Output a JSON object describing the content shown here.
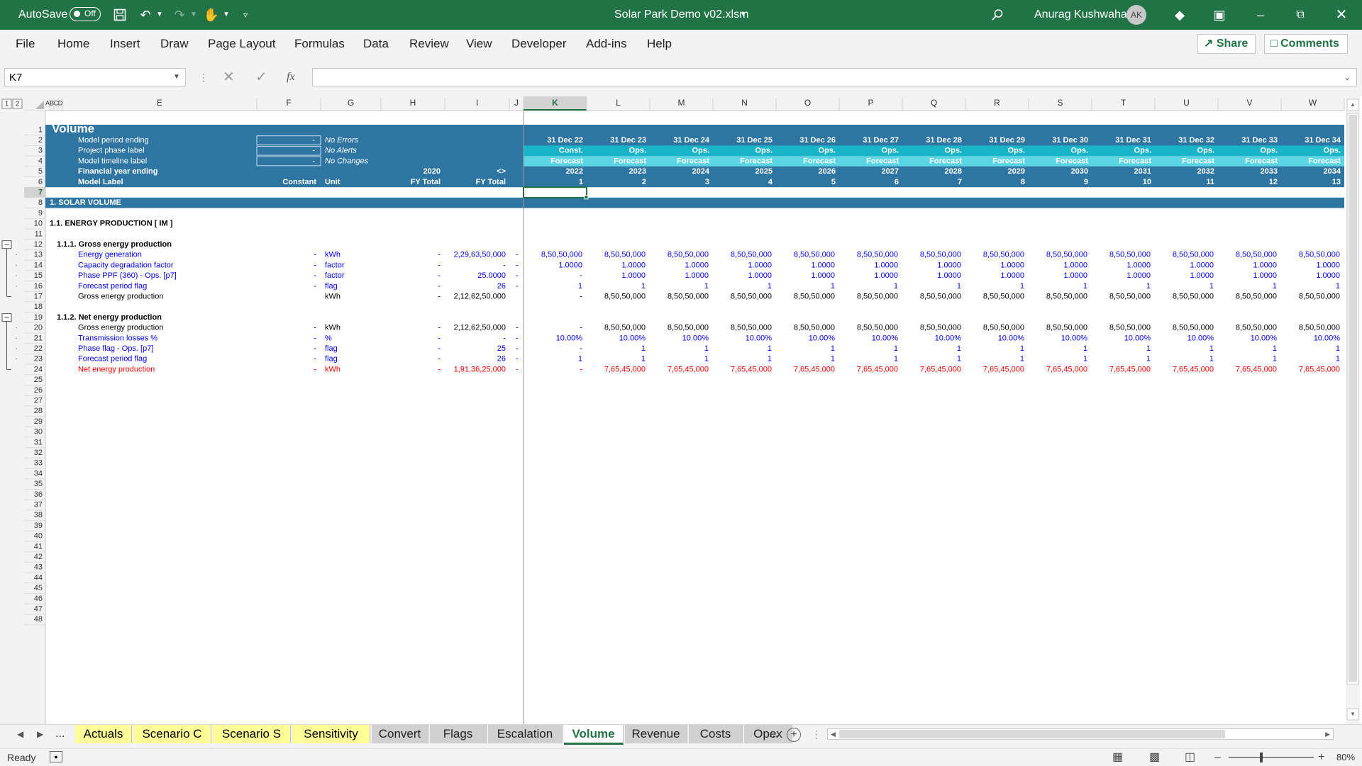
{
  "titlebar": {
    "autosave_label": "AutoSave",
    "autosave_state": "Off",
    "file_name": "Solar Park Demo v02.xlsm",
    "user_name": "Anurag Kushwaha",
    "user_initials": "AK"
  },
  "ribbon": {
    "tabs": [
      "File",
      "Home",
      "Insert",
      "Draw",
      "Page Layout",
      "Formulas",
      "Data",
      "Review",
      "View",
      "Developer",
      "Add-ins",
      "Help"
    ],
    "share_label": "Share",
    "comments_label": "Comments"
  },
  "formula_bar": {
    "name_box": "K7",
    "fx_label": "fx",
    "formula": ""
  },
  "grid": {
    "outline_levels": [
      "1",
      "2"
    ],
    "col_headers": {
      "fixed": [
        "A",
        "B",
        "C",
        "D",
        "E",
        "F",
        "G",
        "H",
        "I",
        "J"
      ],
      "timeline": [
        "K",
        "L",
        "M",
        "N",
        "O",
        "P",
        "Q",
        "R",
        "S",
        "T",
        "U",
        "V",
        "W"
      ]
    },
    "header_block": {
      "title": "Volume",
      "labels": [
        "Model period ending",
        "Project phase label",
        "Model timeline label",
        "Financial year ending",
        "Model Label"
      ],
      "inputs": [
        "-",
        "-",
        "-"
      ],
      "checks": [
        "No Errors",
        "No Alerts",
        "No Changes"
      ],
      "fy_h": "2020",
      "fy_i": "<>",
      "row6": {
        "constant": "Constant",
        "unit": "Unit",
        "h": "FY Total",
        "i": "FY Total"
      },
      "dates": [
        "31 Dec 22",
        "31 Dec 23",
        "31 Dec 24",
        "31 Dec 25",
        "31 Dec 26",
        "31 Dec 27",
        "31 Dec 28",
        "31 Dec 29",
        "31 Dec 30",
        "31 Dec 31",
        "31 Dec 32",
        "31 Dec 33",
        "31 Dec 34"
      ],
      "phases": [
        "Const.",
        "Ops.",
        "Ops.",
        "Ops.",
        "Ops.",
        "Ops.",
        "Ops.",
        "Ops.",
        "Ops.",
        "Ops.",
        "Ops.",
        "Ops.",
        "Ops."
      ],
      "timeline_labels": [
        "Forecast",
        "Forecast",
        "Forecast",
        "Forecast",
        "Forecast",
        "Forecast",
        "Forecast",
        "Forecast",
        "Forecast",
        "Forecast",
        "Forecast",
        "Forecast",
        "Forecast"
      ],
      "fy": [
        "2022",
        "2023",
        "2024",
        "2025",
        "2026",
        "2027",
        "2028",
        "2029",
        "2030",
        "2031",
        "2032",
        "2033",
        "2034"
      ],
      "labels_num": [
        "1",
        "2",
        "3",
        "4",
        "5",
        "6",
        "7",
        "8",
        "9",
        "10",
        "11",
        "12",
        "13"
      ]
    },
    "section_title": "1. SOLAR VOLUME",
    "sub1_title": "1.1. ENERGY PRODUCTION [ IM ]",
    "g1_title": "1.1.1. Gross energy production",
    "g2_title": "1.1.2. Net energy production",
    "rows": [
      {
        "row": 13,
        "label": "Energy generation",
        "f": "-",
        "unit": "kWh",
        "h": "-",
        "i": "2,29,63,50,000",
        "j": "-",
        "style": "input",
        "values": [
          "8,50,50,000",
          "8,50,50,000",
          "8,50,50,000",
          "8,50,50,000",
          "8,50,50,000",
          "8,50,50,000",
          "8,50,50,000",
          "8,50,50,000",
          "8,50,50,000",
          "8,50,50,000",
          "8,50,50,000",
          "8,50,50,000",
          "8,50,50,000"
        ]
      },
      {
        "row": 14,
        "label": "Capacity degradation factor",
        "f": "-",
        "unit": "factor",
        "h": "-",
        "i": "-",
        "j": "-",
        "style": "input",
        "values": [
          "1.0000",
          "1.0000",
          "1.0000",
          "1.0000",
          "1.0000",
          "1.0000",
          "1.0000",
          "1.0000",
          "1.0000",
          "1.0000",
          "1.0000",
          "1.0000",
          "1.0000"
        ]
      },
      {
        "row": 15,
        "label": "Phase PPF (360) - Ops. [p7]",
        "f": "-",
        "unit": "factor",
        "h": "-",
        "i": "25.0000",
        "j": "-",
        "style": "input",
        "values": [
          "-",
          "1.0000",
          "1.0000",
          "1.0000",
          "1.0000",
          "1.0000",
          "1.0000",
          "1.0000",
          "1.0000",
          "1.0000",
          "1.0000",
          "1.0000",
          "1.0000"
        ]
      },
      {
        "row": 16,
        "label": "Forecast period flag",
        "f": "-",
        "unit": "flag",
        "h": "-",
        "i": "26",
        "j": "-",
        "style": "input",
        "values": [
          "1",
          "1",
          "1",
          "1",
          "1",
          "1",
          "1",
          "1",
          "1",
          "1",
          "1",
          "1",
          "1"
        ]
      },
      {
        "row": 17,
        "label": "Gross energy production",
        "f": "",
        "unit": "kWh",
        "h": "-",
        "i": "2,12,62,50,000",
        "j": "",
        "style": "calc",
        "values": [
          "-",
          "8,50,50,000",
          "8,50,50,000",
          "8,50,50,000",
          "8,50,50,000",
          "8,50,50,000",
          "8,50,50,000",
          "8,50,50,000",
          "8,50,50,000",
          "8,50,50,000",
          "8,50,50,000",
          "8,50,50,000",
          "8,50,50,000"
        ]
      },
      {
        "row": 20,
        "label": "Gross energy production",
        "f": "-",
        "unit": "kWh",
        "h": "-",
        "i": "2,12,62,50,000",
        "j": "-",
        "style": "calc",
        "values": [
          "-",
          "8,50,50,000",
          "8,50,50,000",
          "8,50,50,000",
          "8,50,50,000",
          "8,50,50,000",
          "8,50,50,000",
          "8,50,50,000",
          "8,50,50,000",
          "8,50,50,000",
          "8,50,50,000",
          "8,50,50,000",
          "8,50,50,000"
        ]
      },
      {
        "row": 21,
        "label": "Transmission losses %",
        "f": "-",
        "unit": "%",
        "h": "-",
        "i": "-",
        "j": "-",
        "style": "input",
        "values": [
          "10.00%",
          "10.00%",
          "10.00%",
          "10.00%",
          "10.00%",
          "10.00%",
          "10.00%",
          "10.00%",
          "10.00%",
          "10.00%",
          "10.00%",
          "10.00%",
          "10.00%"
        ]
      },
      {
        "row": 22,
        "label": "Phase flag - Ops. [p7]",
        "f": "-",
        "unit": "flag",
        "h": "-",
        "i": "25",
        "j": "-",
        "style": "input",
        "values": [
          "-",
          "1",
          "1",
          "1",
          "1",
          "1",
          "1",
          "1",
          "1",
          "1",
          "1",
          "1",
          "1"
        ]
      },
      {
        "row": 23,
        "label": "Forecast period flag",
        "f": "-",
        "unit": "flag",
        "h": "-",
        "i": "26",
        "j": "-",
        "style": "input",
        "values": [
          "1",
          "1",
          "1",
          "1",
          "1",
          "1",
          "1",
          "1",
          "1",
          "1",
          "1",
          "1",
          "1"
        ]
      },
      {
        "row": 24,
        "label": "Net energy production",
        "f": "-",
        "unit": "kWh",
        "h": "-",
        "i": "1,91,36,25,000",
        "j": "-",
        "style": "output",
        "values": [
          "-",
          "7,65,45,000",
          "7,65,45,000",
          "7,65,45,000",
          "7,65,45,000",
          "7,65,45,000",
          "7,65,45,000",
          "7,65,45,000",
          "7,65,45,000",
          "7,65,45,000",
          "7,65,45,000",
          "7,65,45,000",
          "7,65,45,000"
        ]
      }
    ],
    "colors": {
      "header_blue": "#2e75a2",
      "phase_teal": "#1ab4c9",
      "timeline_cyan": "#5bd4e3",
      "input_blue": "#0000ff",
      "output_red": "#ff0000"
    }
  },
  "sheet_tabs": {
    "left_ellipsis": "...",
    "right_ellipsis": "...",
    "tabs": [
      {
        "name": "Actuals",
        "style": "yellow"
      },
      {
        "name": "Scenario C",
        "style": "yellow"
      },
      {
        "name": "Scenario S",
        "style": "yellow"
      },
      {
        "name": "Sensitivity",
        "style": "yellow"
      },
      {
        "name": "Convert",
        "style": "grey"
      },
      {
        "name": "Flags",
        "style": "grey"
      },
      {
        "name": "Escalation",
        "style": "grey"
      },
      {
        "name": "Volume",
        "style": "active"
      },
      {
        "name": "Revenue",
        "style": "grey"
      },
      {
        "name": "Costs",
        "style": "grey"
      },
      {
        "name": "Opex",
        "style": "grey"
      }
    ]
  },
  "status_bar": {
    "status": "Ready",
    "zoom": "80%"
  }
}
